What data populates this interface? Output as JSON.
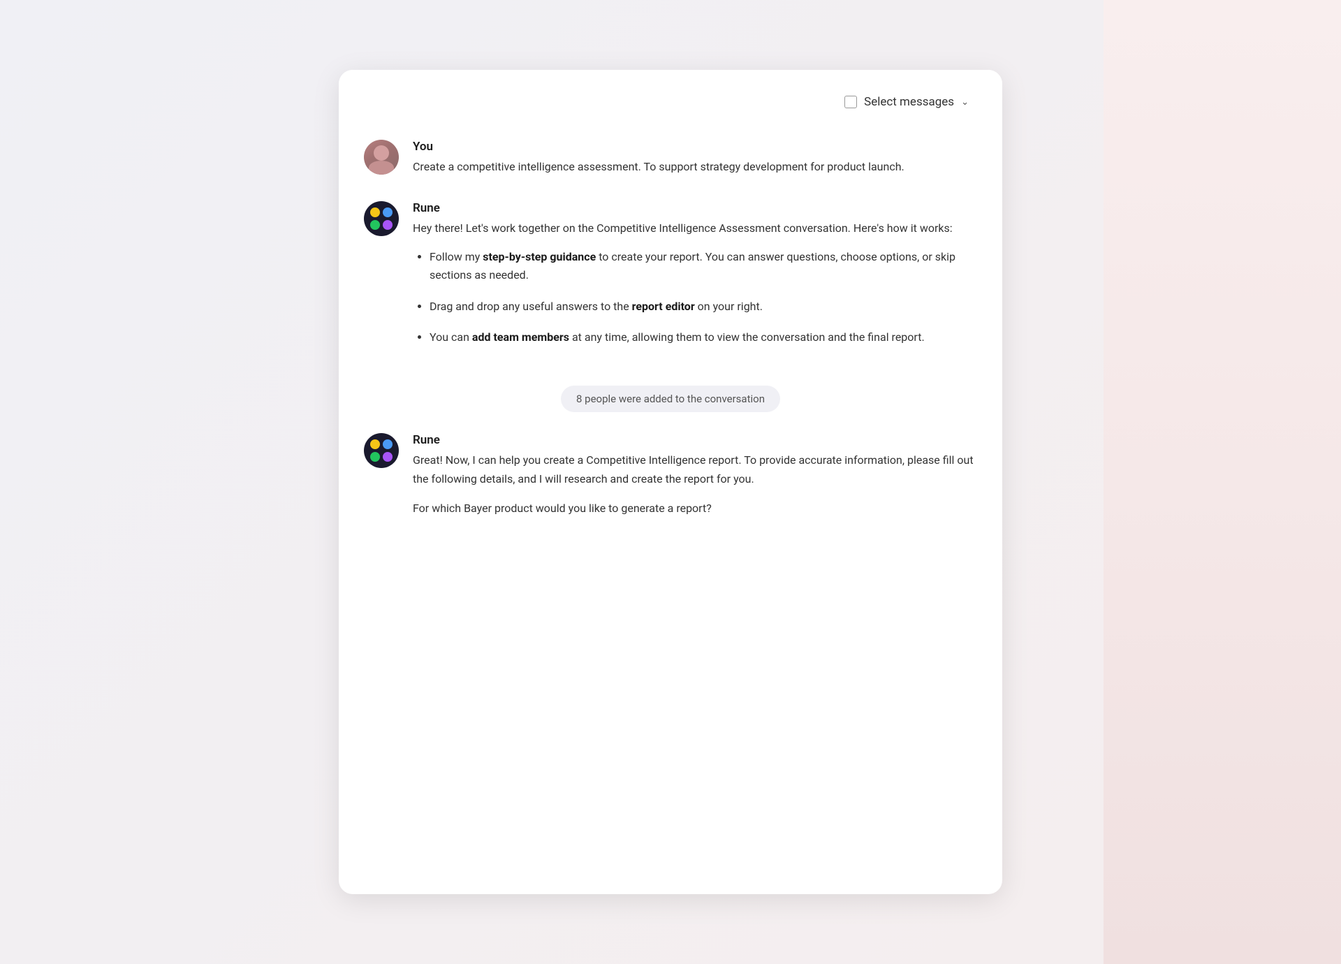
{
  "page": {
    "background": "#f0f0f5"
  },
  "header": {
    "select_messages_label": "Select messages",
    "chevron": "∨"
  },
  "messages": [
    {
      "id": "msg-1",
      "author": "You",
      "avatar_type": "user",
      "text": "Create a competitive intelligence assessment. To support strategy development for product launch."
    },
    {
      "id": "msg-2",
      "author": "Rune",
      "avatar_type": "rune",
      "intro": "Hey there! Let's work together on the Competitive Intelligence Assessment conversation. Here's how it works:",
      "bullets": [
        {
          "text_before": "Follow my ",
          "bold": "step-by-step guidance",
          "text_after": " to create your report. You can answer questions, choose options, or skip sections as needed."
        },
        {
          "text_before": "Drag and drop any useful answers to the ",
          "bold": "report editor",
          "text_after": " on your right."
        },
        {
          "text_before": "You can ",
          "bold": "add team members",
          "text_after": " at any time, allowing them to view the conversation and the final report."
        }
      ]
    }
  ],
  "system_notification": {
    "text": "8 people were added to the conversation"
  },
  "messages_after": [
    {
      "id": "msg-3",
      "author": "Rune",
      "avatar_type": "rune",
      "text": "Great! Now, I can help you create a Competitive Intelligence report. To provide accurate information, please fill out the following details, and I will research and create the report for you.",
      "partial": "For which Bayer product would you like to generate a report?"
    }
  ],
  "dots": {
    "yellow": "#f5c518",
    "blue": "#4a9af5",
    "green": "#22c55e",
    "purple": "#a855f7"
  }
}
